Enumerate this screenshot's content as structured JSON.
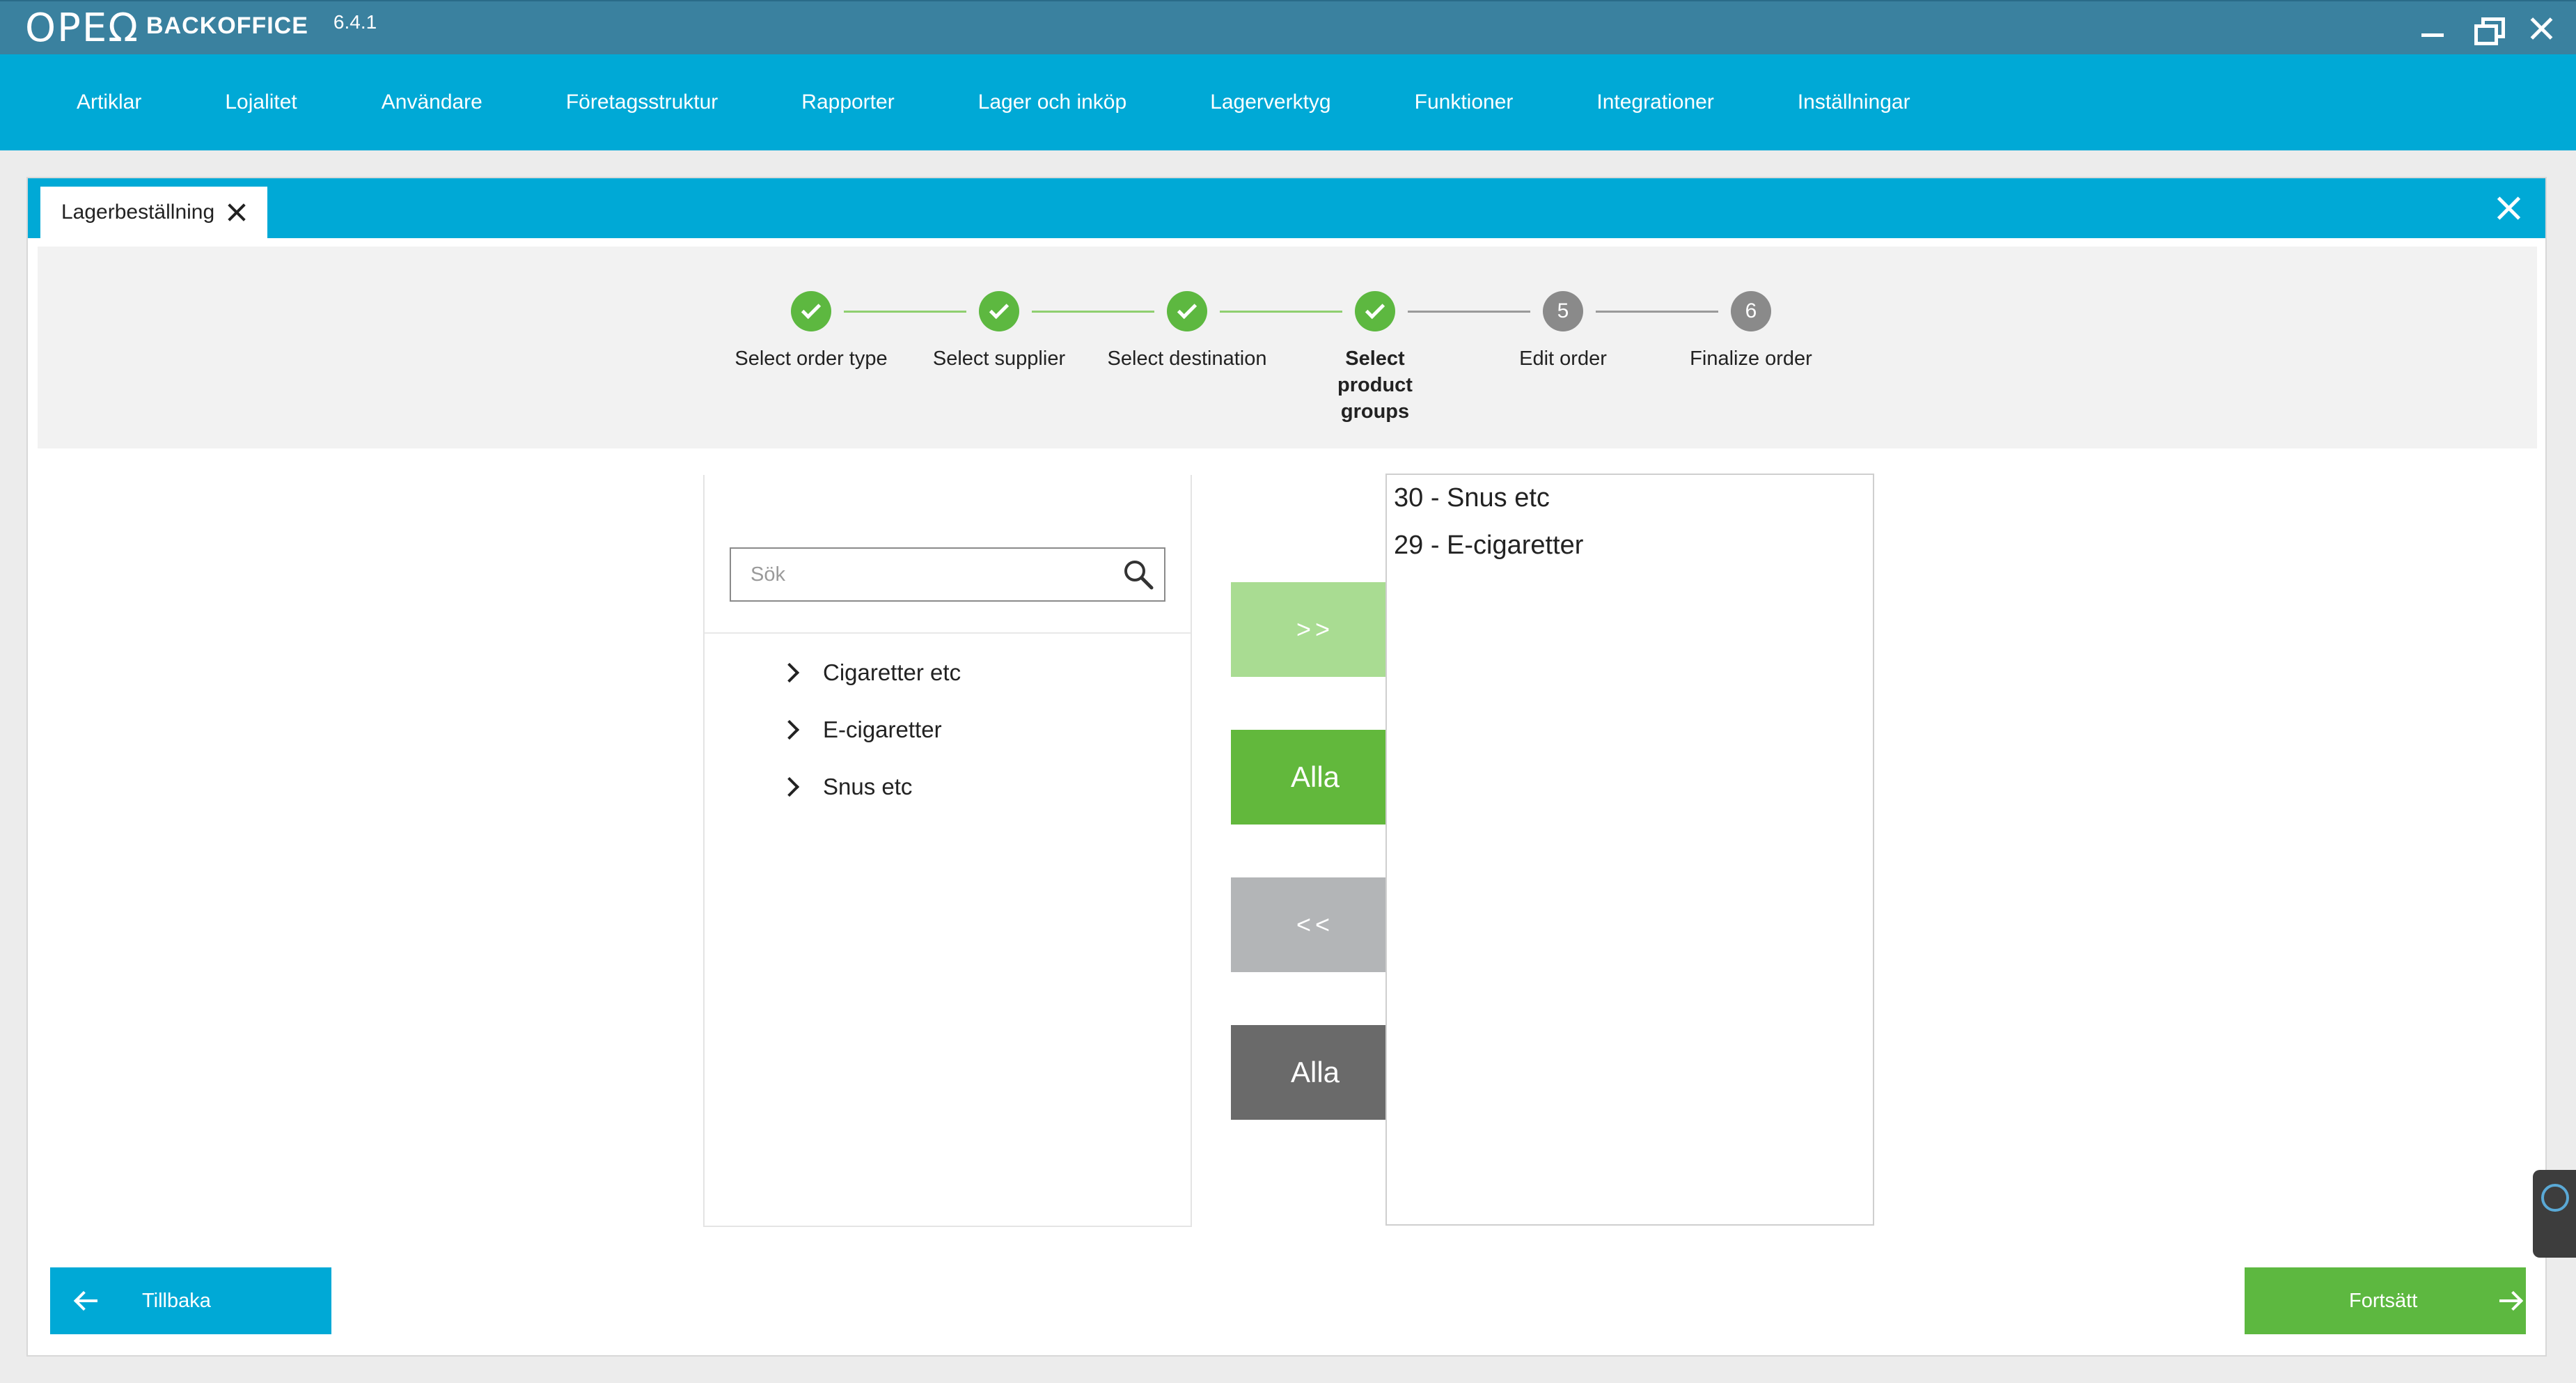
{
  "app": {
    "logo_mark": "ΟΡΕΩ",
    "name": "BACKOFFICE",
    "version": "6.4.1"
  },
  "window_controls": [
    "minimize-icon",
    "restore-icon",
    "close-icon"
  ],
  "menu": [
    {
      "label": "Artiklar"
    },
    {
      "label": "Lojalitet"
    },
    {
      "label": "Användare"
    },
    {
      "label": "Företagsstruktur"
    },
    {
      "label": "Rapporter"
    },
    {
      "label": "Lager och inköp"
    },
    {
      "label": "Lagerverktyg"
    },
    {
      "label": "Funktioner"
    },
    {
      "label": "Integrationer"
    },
    {
      "label": "Inställningar"
    }
  ],
  "tab": {
    "label": "Lagerbeställning"
  },
  "stepper": {
    "steps": [
      {
        "label": "Select order type",
        "number": "1",
        "state": "done"
      },
      {
        "label": "Select supplier",
        "number": "2",
        "state": "done"
      },
      {
        "label": "Select destination",
        "number": "3",
        "state": "done"
      },
      {
        "label": "Select product groups",
        "number": "4",
        "state": "done"
      },
      {
        "label": "Edit order",
        "number": "5",
        "state": "todo"
      },
      {
        "label": "Finalize order",
        "number": "6",
        "state": "todo"
      }
    ],
    "active_index": 3
  },
  "search": {
    "placeholder": "Sök",
    "value": ""
  },
  "available_groups": [
    {
      "label": "Cigaretter etc"
    },
    {
      "label": "E-cigaretter"
    },
    {
      "label": "Snus etc"
    }
  ],
  "transfer_buttons": {
    "add": ">>",
    "add_all": "Alla",
    "remove": "<<",
    "remove_all": "Alla"
  },
  "selected_groups": [
    {
      "label": "30 - Snus etc"
    },
    {
      "label": "29 - E-cigaretter"
    }
  ],
  "footer": {
    "back_label": "Tillbaka",
    "next_label": "Fortsätt"
  },
  "colors": {
    "titlebar": "#3a819f",
    "accent": "#00a9d6",
    "success": "#5db840",
    "success_light": "#a9dc92",
    "neutral": "#b3b5b7",
    "dark": "#6a6a6a"
  }
}
